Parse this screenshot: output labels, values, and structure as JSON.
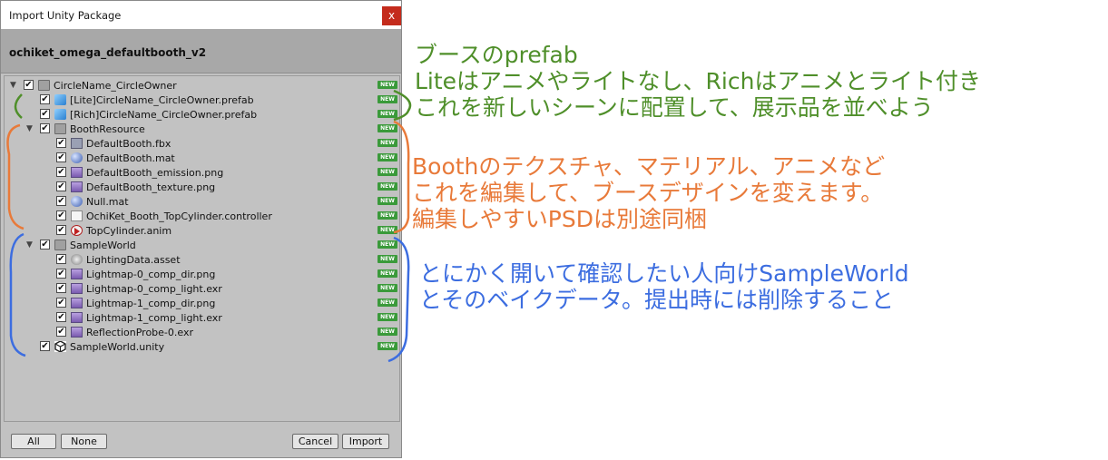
{
  "window": {
    "title": "Import Unity Package",
    "close_glyph": "x"
  },
  "package_name": "ochiket_omega_defaultbooth_v2",
  "badge": "NEW",
  "tree": [
    {
      "label": "CircleName_CircleOwner",
      "icon": "folder-icon",
      "indent": 0,
      "arrow": "▼"
    },
    {
      "label": "[Lite]CircleName_CircleOwner.prefab",
      "icon": "prefab-icon",
      "indent": 1
    },
    {
      "label": "[Rich]CircleName_CircleOwner.prefab",
      "icon": "prefab-icon",
      "indent": 1
    },
    {
      "label": "BoothResource",
      "icon": "folder-icon",
      "indent": 1,
      "arrow": "▼"
    },
    {
      "label": "DefaultBooth.fbx",
      "icon": "fbx-icon",
      "indent": 2
    },
    {
      "label": "DefaultBooth.mat",
      "icon": "material-icon",
      "indent": 2
    },
    {
      "label": "DefaultBooth_emission.png",
      "icon": "texture-icon",
      "indent": 2
    },
    {
      "label": "DefaultBooth_texture.png",
      "icon": "texture-icon",
      "indent": 2
    },
    {
      "label": "Null.mat",
      "icon": "material-icon",
      "indent": 2
    },
    {
      "label": "OchiKet_Booth_TopCylinder.controller",
      "icon": "controller-icon",
      "indent": 2
    },
    {
      "label": "TopCylinder.anim",
      "icon": "animation-icon",
      "indent": 2
    },
    {
      "label": "SampleWorld",
      "icon": "folder-icon",
      "indent": 1,
      "arrow": "▼"
    },
    {
      "label": "LightingData.asset",
      "icon": "lighting-asset-icon",
      "indent": 2
    },
    {
      "label": "Lightmap-0_comp_dir.png",
      "icon": "texture-icon",
      "indent": 2
    },
    {
      "label": "Lightmap-0_comp_light.exr",
      "icon": "texture-icon",
      "indent": 2
    },
    {
      "label": "Lightmap-1_comp_dir.png",
      "icon": "texture-icon",
      "indent": 2
    },
    {
      "label": "Lightmap-1_comp_light.exr",
      "icon": "texture-icon",
      "indent": 2
    },
    {
      "label": "ReflectionProbe-0.exr",
      "icon": "texture-icon",
      "indent": 2
    },
    {
      "label": "SampleWorld.unity",
      "icon": "unity-scene-icon",
      "indent": 1
    }
  ],
  "buttons": {
    "all": "All",
    "none": "None",
    "cancel": "Cancel",
    "import": "Import"
  },
  "annotations": {
    "green": [
      "ブースのprefab",
      "Liteはアニメやライトなし、Richはアニメとライト付き",
      "これを新しいシーンに配置して、展示品を並べよう"
    ],
    "orange": [
      "Boothのテクスチャ、マテリアル、アニメなど",
      "これを編集して、ブースデザインを変えます。",
      "編集しやすいPSDは別途同梱"
    ],
    "blue": [
      "とにかく開いて確認したい人向けSampleWorld",
      "とそのベイクデータ。提出時には削除すること"
    ]
  },
  "colors": {
    "green": "#4f8f2a",
    "orange": "#e87a3a",
    "blue": "#3c6de0",
    "new_badge": "#3a9a3a",
    "close": "#c42b1c"
  }
}
